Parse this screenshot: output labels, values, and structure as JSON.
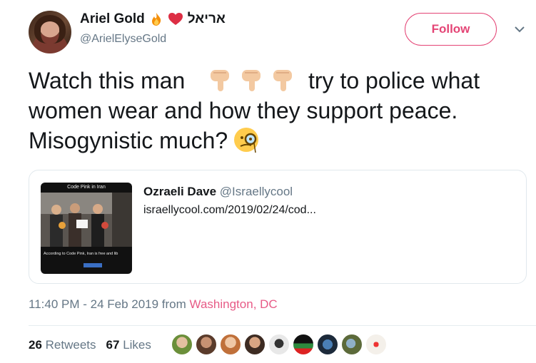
{
  "author": {
    "display_name": "Ariel Gold",
    "hebrew_name": "אריאל",
    "handle": "@ArielElyseGold"
  },
  "follow_label": "Follow",
  "tweet": {
    "line1_before": "Watch this man",
    "line1_after": "try to police what",
    "line2": "women wear and how they support peace.",
    "line3": "Misogynistic much?"
  },
  "card": {
    "name": "Ozraeli Dave",
    "handle": "@Israellycool",
    "url": "israellycool.com/2019/02/24/cod...",
    "thumb_title": "Code Pink in Iran",
    "thumb_caption": "According to Code Pink, Iran is free and lib"
  },
  "meta": {
    "time": "11:40 PM - 24 Feb 2019 from",
    "location": "Washington, DC"
  },
  "stats": {
    "retweets_count": "26",
    "retweets_label": "Retweets",
    "likes_count": "67",
    "likes_label": "Likes"
  },
  "icons": [
    "fire-icon",
    "heart-icon",
    "chevron-down-icon",
    "pointing-down-hand-icon",
    "face-with-monocle-icon"
  ],
  "colors": {
    "accent": "#e0245e",
    "secondary_text": "#657786",
    "text": "#14171a",
    "border": "#e1e8ed"
  }
}
